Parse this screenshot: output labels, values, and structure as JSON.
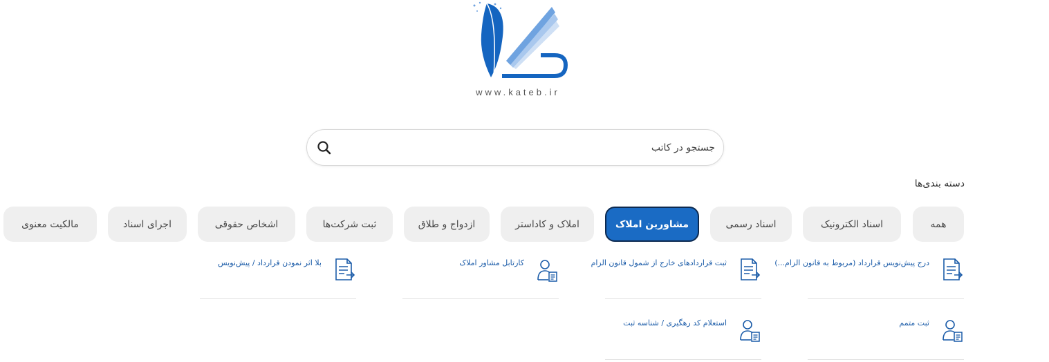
{
  "logo": {
    "text": "www.kateb.ir",
    "icon": "feather-book-logo"
  },
  "search": {
    "placeholder": "جستجو در کاتب",
    "icon": "search-icon"
  },
  "categories": {
    "title": "دسته بندی‌ها",
    "tabs": [
      {
        "label": "همه",
        "active": false
      },
      {
        "label": "اسناد الکترونیک",
        "active": false
      },
      {
        "label": "اسناد رسمی",
        "active": false
      },
      {
        "label": "مشاورین املاک",
        "active": true
      },
      {
        "label": "املاک و کاداستر",
        "active": false
      },
      {
        "label": "ازدواج و طلاق",
        "active": false
      },
      {
        "label": "ثبت شرکت‌ها",
        "active": false
      },
      {
        "label": "اشخاص حقوقی",
        "active": false
      },
      {
        "label": "اجرای اسناد",
        "active": false
      },
      {
        "label": "مالکیت معنوی",
        "active": false
      }
    ]
  },
  "items": [
    {
      "label": "درج پیش‌نویس قرارداد (مربوط به قانون الزام...)",
      "icon": "document-arrow-icon"
    },
    {
      "label": "ثبت قراردادهای خارج از شمول قانون الزام",
      "icon": "document-arrow-icon"
    },
    {
      "label": "کارتابل مشاور املاک",
      "icon": "person-document-icon"
    },
    {
      "label": "بلا اثر نمودن قرارداد / پیش‌نویس",
      "icon": "document-arrow-icon"
    },
    {
      "label": "ثبت متمم",
      "icon": "person-document-icon"
    },
    {
      "label": "استعلام کد رهگیری / شناسه ثبت",
      "icon": "person-document-icon"
    }
  ],
  "colors": {
    "accent": "#1a6bc4",
    "link": "#1a5ba8",
    "tab_bg": "#efefef"
  }
}
